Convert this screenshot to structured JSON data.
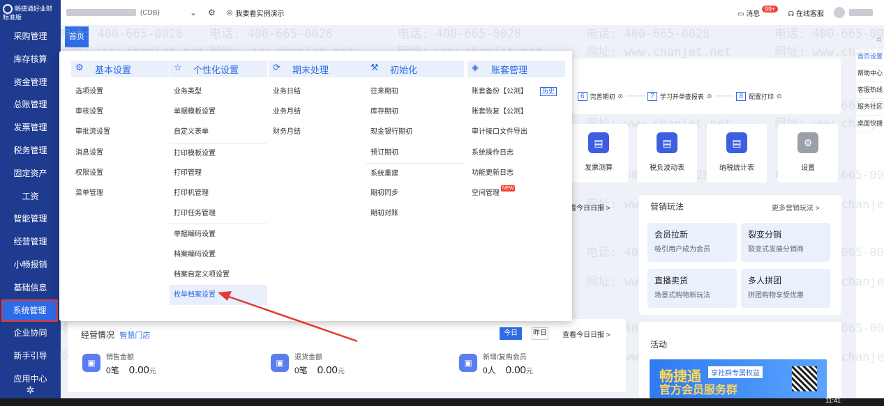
{
  "app": {
    "name": "畅捷通好业财",
    "edition": "标准版"
  },
  "sidebar": {
    "items": [
      {
        "label": "采购管理",
        "active": false
      },
      {
        "label": "库存核算",
        "active": false
      },
      {
        "label": "资金管理",
        "active": false
      },
      {
        "label": "总账管理",
        "active": false
      },
      {
        "label": "发票管理",
        "active": false
      },
      {
        "label": "税务管理",
        "active": false
      },
      {
        "label": "固定资产",
        "active": false
      },
      {
        "label": "工资",
        "active": false
      },
      {
        "label": "智能管理",
        "active": false
      },
      {
        "label": "经营管理",
        "active": false
      },
      {
        "label": "小畅报销",
        "active": false
      },
      {
        "label": "基础信息",
        "active": false
      },
      {
        "label": "系统管理",
        "active": true
      },
      {
        "label": "企业协同",
        "active": false
      },
      {
        "label": "新手引导",
        "active": false
      },
      {
        "label": "应用中心",
        "active": false
      }
    ]
  },
  "topbar": {
    "company_suffix": "(CDB)",
    "demo_link": "我要看实例演示",
    "messages_label": "消息",
    "messages_badge": "99+",
    "service_label": "在线客服"
  },
  "tabs": {
    "home": "首页"
  },
  "help_column": [
    "首页设置",
    "帮助中心",
    "客服热线",
    "服务社区",
    "桌面快捷"
  ],
  "menu": {
    "columns": [
      {
        "title": "基本设置",
        "icon": "gear-icon",
        "items": [
          "选项设置",
          "审核设置",
          "审批流设置",
          "消息设置",
          "权限设置",
          "菜单管理"
        ]
      },
      {
        "title": "个性化设置",
        "icon": "star-icon",
        "items": [
          "业务类型",
          "单据模板设置",
          "自定义表单",
          "打印模板设置",
          "打印管理",
          "打印机管理",
          "打印任务管理",
          "单据编码设置",
          "档案编码设置",
          "档案自定义项设置",
          "枚举档案设置"
        ],
        "highlighted": "枚举档案设置"
      },
      {
        "title": "期末处理",
        "icon": "period-end-icon",
        "items": [
          "业务日结",
          "业务月结",
          "财务月结"
        ]
      },
      {
        "title": "初始化",
        "icon": "init-icon",
        "items": [
          "往来期初",
          "库存期初",
          "现金银行期初",
          "预订期初",
          "系统重建",
          "期初同步",
          "期初对账"
        ]
      },
      {
        "title": "账套管理",
        "icon": "account-set-icon",
        "items": [
          "账套备份【公测】",
          "账套恢复【公测】",
          "审计接口文件导出",
          "系统操作日志",
          "功能更新日志",
          "空间管理"
        ],
        "history_tag": "历史",
        "new_tag": "NEW"
      }
    ]
  },
  "steps": [
    {
      "num": "6",
      "label": "完善期初"
    },
    {
      "num": "7",
      "label": "学习开单查报表"
    },
    {
      "num": "8",
      "label": "配置打印"
    }
  ],
  "tools": [
    {
      "label": "发票测算",
      "icon": "invoice-calc-icon"
    },
    {
      "label": "税负波动表",
      "icon": "tax-chart-icon"
    },
    {
      "label": "纳税统计表",
      "icon": "tax-stats-icon"
    },
    {
      "label": "设置",
      "icon": "settings-icon"
    }
  ],
  "daily_link": "看今日日报 >",
  "marketing": {
    "title": "营销玩法",
    "more": "更多营销玩法 >",
    "cards": [
      {
        "title": "会员拉新",
        "sub": "吸引用户成为会员"
      },
      {
        "title": "裂变分销",
        "sub": "裂变式发展分销商"
      },
      {
        "title": "直播卖货",
        "sub": "场景式购物新玩法"
      },
      {
        "title": "多人拼团",
        "sub": "拼团购物享受优惠"
      }
    ]
  },
  "business": {
    "title": "经营情况",
    "store": "智慧门店",
    "today": "今日",
    "yesterday": "昨日",
    "daily_report": "查看今日日报 >",
    "metrics": [
      {
        "label": "销售金额",
        "count": "0笔",
        "amount": "0.00",
        "unit": "元"
      },
      {
        "label": "退货金额",
        "count": "0笔",
        "amount": "0.00",
        "unit": "元"
      },
      {
        "label": "新增/复购会员",
        "count": "0人",
        "amount": "0.00",
        "unit": "元"
      }
    ]
  },
  "activity": {
    "title": "活动",
    "banner_big": "畅捷通",
    "banner_sub": "享社群专属权益",
    "banner_bottom": "官方会员服务群"
  },
  "watermark": {
    "phone": "电话: 400-665-0028",
    "site": "网址: www.chanjet.net"
  },
  "taskbar": {
    "time": "11:41"
  },
  "colors": {
    "sidebar": "#1f3b8f",
    "accent": "#2e6be6",
    "highlight_border": "#e53935"
  }
}
